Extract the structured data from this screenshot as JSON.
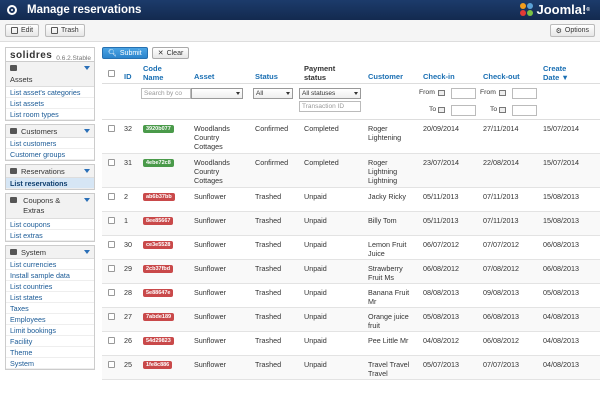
{
  "app": {
    "title": "Manage reservations",
    "brand": "Joomla!",
    "brand_mark": "®"
  },
  "toolbar": {
    "edit_label": "Edit",
    "trash_label": "Trash",
    "options_label": "Options"
  },
  "sidebar": {
    "logo": "solidres",
    "version": "0.6.2.Stable",
    "groups": [
      {
        "title": "Assets",
        "items": [
          "List asset's categories",
          "List assets",
          "List room types"
        ]
      },
      {
        "title": "Customers",
        "items": [
          "List customers",
          "Customer groups"
        ]
      },
      {
        "title": "Reservations",
        "items": [
          "List reservations"
        ]
      },
      {
        "title": "Coupons & Extras",
        "items": [
          "List coupons",
          "List extras"
        ]
      },
      {
        "title": "System",
        "items": [
          "List currencies",
          "Install sample data",
          "List countries",
          "List states",
          "Taxes",
          "Employees",
          "Limit bookings",
          "Facility",
          "Theme",
          "System"
        ]
      }
    ]
  },
  "actions": {
    "submit_label": "Submit",
    "clear_label": "Clear"
  },
  "columns": {
    "id": "ID",
    "code_line1": "Code",
    "code_line2": "Name",
    "asset": "Asset",
    "status": "Status",
    "payment_line1": "Payment",
    "payment_line2": "status",
    "customer": "Customer",
    "checkin": "Check-in",
    "checkout": "Check-out",
    "create_line1": "Create",
    "create_line2": "Date ▼"
  },
  "filters": {
    "search_placeholder": "Search by co",
    "status_value": "All",
    "payment_value": "All statuses",
    "transaction_placeholder": "Transaction ID",
    "from_label": "From",
    "to_label": "To"
  },
  "rows": [
    {
      "id": "32",
      "code": "3920b077",
      "badge": "green",
      "asset": [
        "Woodlands",
        "Country",
        "Cottages"
      ],
      "status": "Confirmed",
      "payment": "Completed",
      "customer": [
        "Roger",
        "Lightening"
      ],
      "checkin": "20/09/2014",
      "checkout": "27/11/2014",
      "created": "15/07/2014"
    },
    {
      "id": "31",
      "code": "4ebe72c8",
      "badge": "green",
      "asset": [
        "Woodlands",
        "Country",
        "Cottages"
      ],
      "status": "Confirmed",
      "payment": "Completed",
      "customer": [
        "Roger",
        "Lightning",
        "Lightning"
      ],
      "checkin": "23/07/2014",
      "checkout": "22/08/2014",
      "created": "15/07/2014"
    },
    {
      "id": "2",
      "code": "ab6b37bb",
      "badge": "red",
      "asset": [
        "Sunflower"
      ],
      "status": "Trashed",
      "payment": "Unpaid",
      "customer": [
        "Jacky Ricky"
      ],
      "checkin": "05/11/2013",
      "checkout": "07/11/2013",
      "created": "15/08/2013"
    },
    {
      "id": "1",
      "code": "8ee85667",
      "badge": "red",
      "asset": [
        "Sunflower"
      ],
      "status": "Trashed",
      "payment": "Unpaid",
      "customer": [
        "Billy Tom"
      ],
      "checkin": "05/11/2013",
      "checkout": "07/11/2013",
      "created": "15/08/2013"
    },
    {
      "id": "30",
      "code": "ce3e5528",
      "badge": "red",
      "asset": [
        "Sunflower"
      ],
      "status": "Trashed",
      "payment": "Unpaid",
      "customer": [
        "Lemon Fruit",
        "Juice"
      ],
      "checkin": "06/07/2012",
      "checkout": "07/07/2012",
      "created": "06/08/2013"
    },
    {
      "id": "29",
      "code": "2cb37fbd",
      "badge": "red",
      "asset": [
        "Sunflower"
      ],
      "status": "Trashed",
      "payment": "Unpaid",
      "customer": [
        "Strawberry",
        "Fruit Ms"
      ],
      "checkin": "06/08/2012",
      "checkout": "07/08/2012",
      "created": "06/08/2013"
    },
    {
      "id": "28",
      "code": "5e88647e",
      "badge": "red",
      "asset": [
        "Sunflower"
      ],
      "status": "Trashed",
      "payment": "Unpaid",
      "customer": [
        "Banana Fruit",
        "Mr"
      ],
      "checkin": "08/08/2013",
      "checkout": "09/08/2013",
      "created": "05/08/2013"
    },
    {
      "id": "27",
      "code": "7abde189",
      "badge": "red",
      "asset": [
        "Sunflower"
      ],
      "status": "Trashed",
      "payment": "Unpaid",
      "customer": [
        "Orange juice",
        "fruit"
      ],
      "checkin": "05/08/2013",
      "checkout": "06/08/2013",
      "created": "04/08/2013"
    },
    {
      "id": "26",
      "code": "54d29823",
      "badge": "red",
      "asset": [
        "Sunflower"
      ],
      "status": "Trashed",
      "payment": "Unpaid",
      "customer": [
        "Pee Little Mr"
      ],
      "checkin": "04/08/2012",
      "checkout": "06/08/2012",
      "created": "04/08/2013"
    },
    {
      "id": "25",
      "code": "1fe8c886",
      "badge": "red",
      "asset": [
        "Sunflower"
      ],
      "status": "Trashed",
      "payment": "Unpaid",
      "customer": [
        "Travel Travel",
        "Travel"
      ],
      "checkin": "05/07/2013",
      "checkout": "07/07/2013",
      "created": "04/08/2013"
    }
  ],
  "colors": {
    "header_bg": "#1c3b6b",
    "link": "#1a6fb3",
    "badge_green": "#4a9a4a",
    "badge_red": "#c9494a",
    "active_nav": "#d6e6f5"
  },
  "icons": [
    "joomla-ring-icon",
    "joomla-logo-icon",
    "edit-icon",
    "trash-icon",
    "gear-icon",
    "home-icon",
    "user-icon",
    "pin-icon",
    "coupon-icon",
    "list-icon",
    "calendar-icon",
    "check-icon",
    "close-icon"
  ]
}
